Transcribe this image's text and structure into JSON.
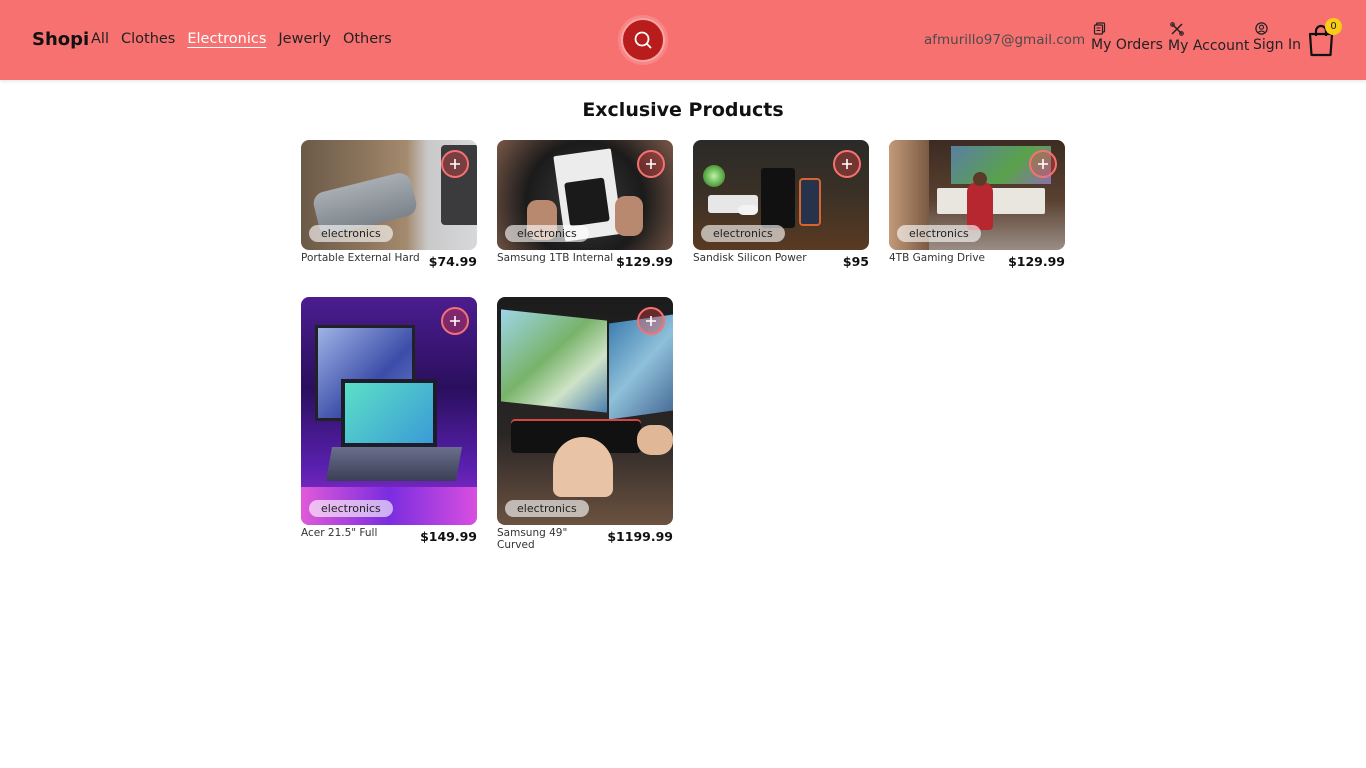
{
  "brand": "Shopi",
  "nav": {
    "links": [
      {
        "label": "All"
      },
      {
        "label": "Clothes"
      },
      {
        "label": "Electronics"
      },
      {
        "label": "Jewerly"
      },
      {
        "label": "Others"
      }
    ],
    "active_link": "Electronics",
    "email": "afmurillo97@gmail.com",
    "my_orders": "My Orders",
    "my_account": "My Account",
    "sign_in": "Sign In",
    "cart_count": "0"
  },
  "page_title": "Exclusive Products",
  "products": [
    {
      "category": "electronics",
      "name": "Portable External Hard",
      "price": "$74.99"
    },
    {
      "category": "electronics",
      "name": "Samsung 1TB Internal",
      "price": "$129.99"
    },
    {
      "category": "electronics",
      "name": "Sandisk Silicon Power",
      "price": "$95"
    },
    {
      "category": "electronics",
      "name": "4TB Gaming Drive",
      "price": "$129.99"
    },
    {
      "category": "electronics",
      "name": "Acer 21.5\" Full",
      "price": "$149.99"
    },
    {
      "category": "electronics",
      "name": "Samsung 49\" Curved",
      "price": "$1199.99"
    }
  ],
  "colors": {
    "navbar": "#f87171",
    "accent": "#ef4444",
    "badge_count": "#facc15"
  }
}
